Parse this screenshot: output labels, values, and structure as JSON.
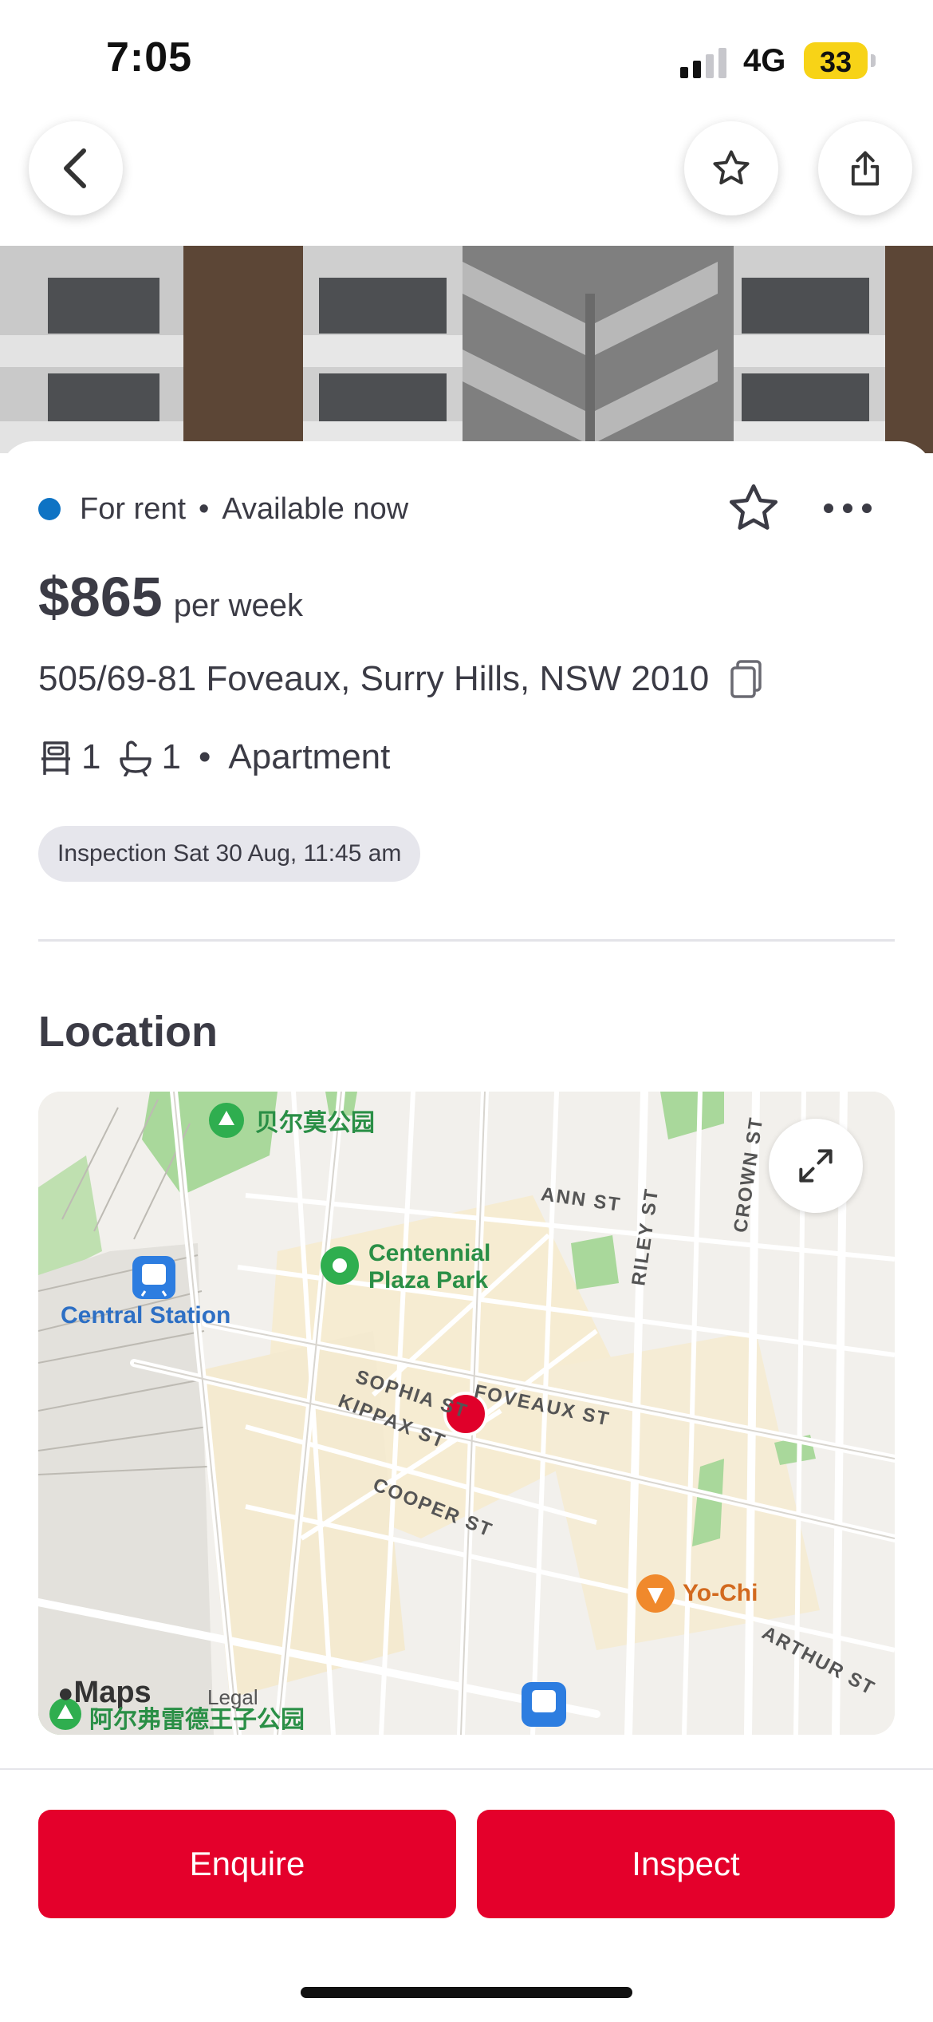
{
  "status_bar": {
    "time": "7:05",
    "network": "4G",
    "battery": "33"
  },
  "listing": {
    "status": "For rent",
    "availability": "Available now",
    "price": "$865",
    "price_suffix": "per week",
    "address": "505/69-81 Foveaux, Surry Hills, NSW 2010",
    "bedrooms": "1",
    "bathrooms": "1",
    "property_type": "Apartment",
    "inspection": "Inspection Sat 30 Aug, 11:45 am"
  },
  "location": {
    "title": "Location",
    "map_labels": {
      "park_belmore": "贝尔莫公园",
      "ann_st": "ANN ST",
      "crown_st": "CROWN ST",
      "riley_st": "RILEY ST",
      "centennial_line1": "Centennial",
      "centennial_line2": "Plaza Park",
      "central_station": "Central Station",
      "sophia_st": "SOPHIA ST",
      "foveaux_st": "FOVEAUX ST",
      "kippax_st": "KIPPAX ST",
      "cooper_st": "COOPER ST",
      "yo_chi": "Yo-Chi",
      "arthur_st": "ARTHUR ST",
      "maps_brand": "Maps",
      "legal": "Legal",
      "prince_alfred_park": "阿尔弗雷德王子公园"
    }
  },
  "actions": {
    "enquire": "Enquire",
    "inspect": "Inspect"
  },
  "colors": {
    "accent_red": "#e4002b",
    "status_blue": "#0e73c4",
    "battery_yellow": "#f7d317"
  }
}
